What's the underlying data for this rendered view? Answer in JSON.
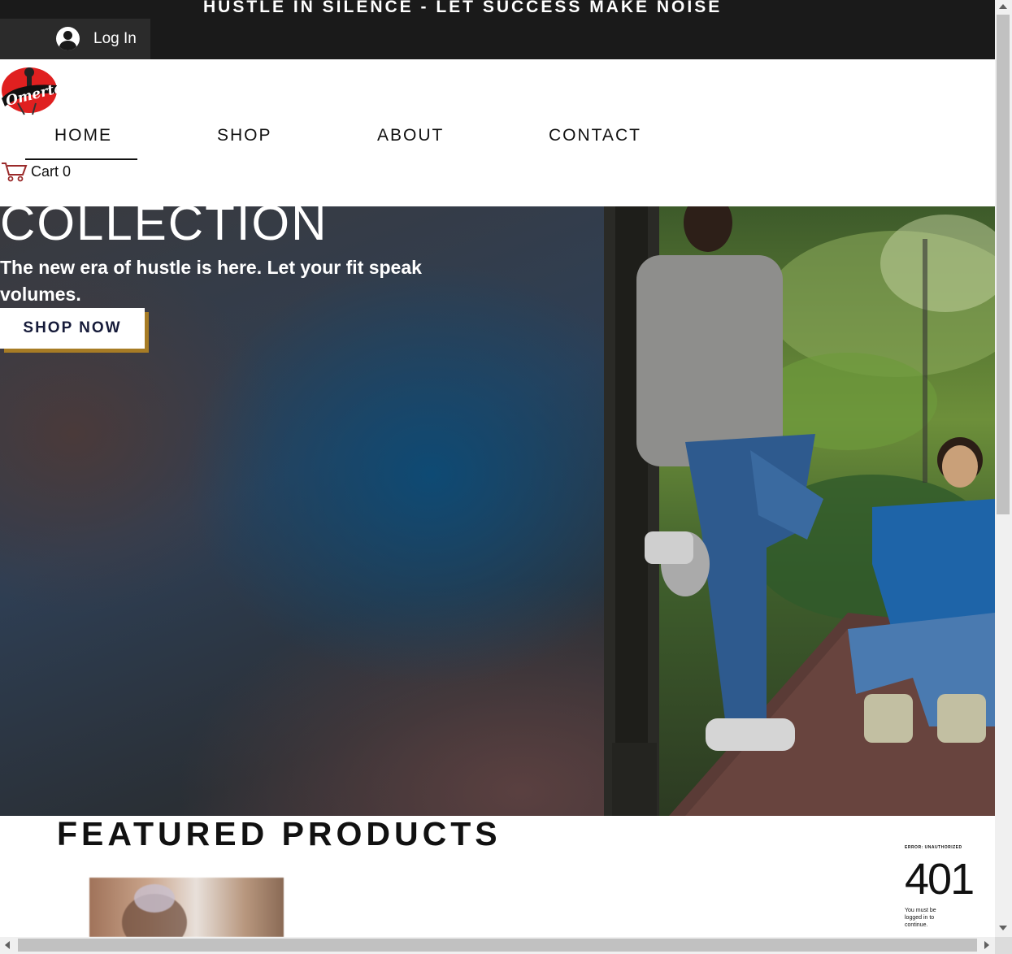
{
  "topbar": {
    "tagline": "HUSTLE IN SILENCE - LET SUCCESS MAKE NOISE",
    "login_label": "Log In",
    "background": "#1a1a1a"
  },
  "header": {
    "logo_text": "Omerta",
    "nav": [
      {
        "label": "HOME",
        "active": true
      },
      {
        "label": "SHOP",
        "active": false
      },
      {
        "label": "ABOUT",
        "active": false
      },
      {
        "label": "CONTACT",
        "active": false
      }
    ],
    "cart_label": "Cart 0"
  },
  "hero": {
    "title": "COLLECTION",
    "subtitle": "The new era of hustle is here. Let your fit speak volumes.",
    "cta_label": "SHOP NOW",
    "cta_shadow_color": "#a77c25",
    "cta_text_color": "#161b3a"
  },
  "featured": {
    "title": "FEATURED PRODUCTS"
  },
  "error_widget": {
    "label": "ERROR: UNAUTHORIZED",
    "code": "401",
    "message": "You must be logged in to continue."
  },
  "icons": {
    "login": "user-avatar-icon",
    "cart": "shopping-cart-icon"
  }
}
